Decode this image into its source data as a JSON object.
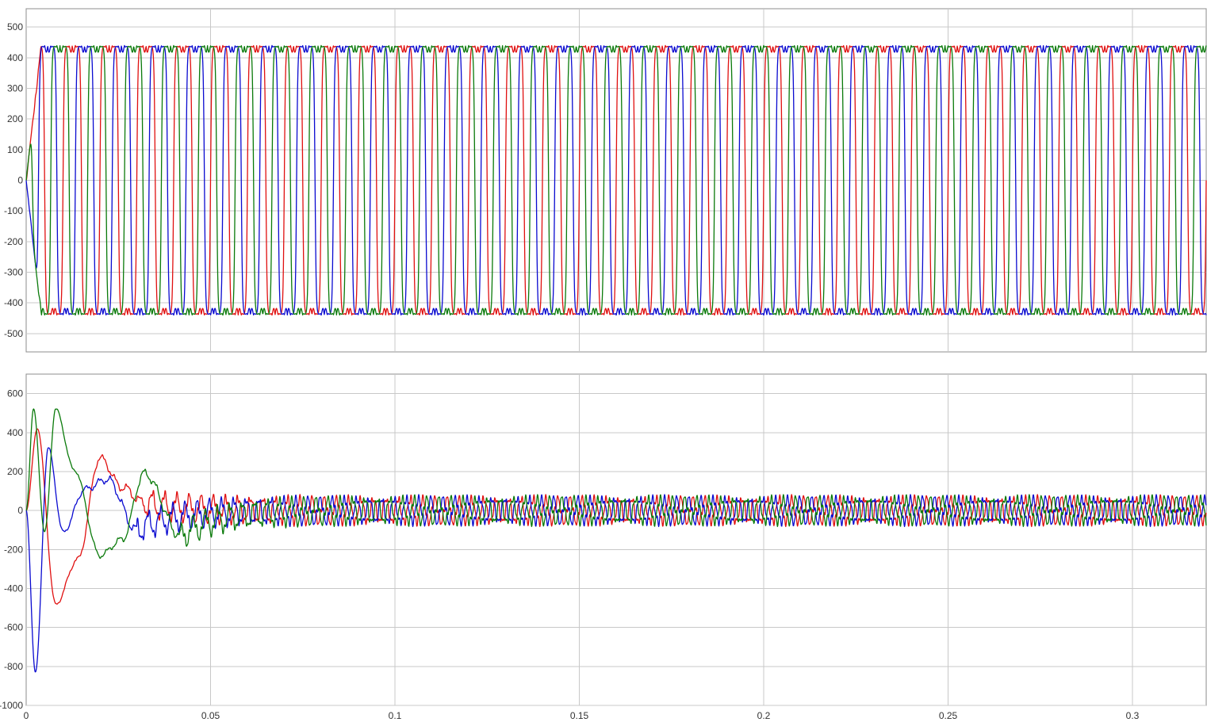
{
  "chart_data": [
    {
      "type": "line",
      "title": "",
      "xlabel": "",
      "ylabel": "",
      "grid": true,
      "xlim": [
        0,
        0.32
      ],
      "ylim": [
        -560,
        560
      ],
      "xticks": [
        0,
        0.05,
        0.1,
        0.15,
        0.2,
        0.25,
        0.3
      ],
      "xtick_labels": [
        "",
        "",
        "",
        "",
        "",
        "",
        ""
      ],
      "yticks": [
        500,
        400,
        300,
        200,
        100,
        0,
        -100,
        -200,
        -300,
        -400,
        -500
      ],
      "ytick_labels": [
        "500",
        "400",
        "300",
        "200",
        "100",
        "0",
        "-100",
        "-200",
        "-300",
        "-400",
        "-500"
      ],
      "series_colors": [
        "#e01010",
        "#0a0ad0",
        "#0a7a0a"
      ],
      "series": [
        {
          "values": {
            "shape": "three-phase quasi-square wave with double peaks",
            "frequency_hz": 100,
            "amplitude": 440,
            "phase_deg": 0
          }
        },
        {
          "values": {
            "shape": "three-phase quasi-square wave with double peaks",
            "frequency_hz": 100,
            "amplitude": 440,
            "phase_deg": -120
          }
        },
        {
          "values": {
            "shape": "three-phase quasi-square wave with double peaks",
            "frequency_hz": 100,
            "amplitude": 440,
            "phase_deg": 120
          }
        }
      ]
    },
    {
      "type": "line",
      "title": "",
      "xlabel": "",
      "ylabel": "",
      "grid": true,
      "xlim": [
        0,
        0.32
      ],
      "ylim": [
        -1000,
        700
      ],
      "xticks": [
        0,
        0.05,
        0.1,
        0.15,
        0.2,
        0.25,
        0.3
      ],
      "xtick_labels": [
        "0",
        "0.05",
        "0.1",
        "0.15",
        "0.2",
        "0.25",
        "0.3"
      ],
      "yticks": [
        600,
        400,
        200,
        0,
        -200,
        -400,
        -600,
        -800,
        -1000
      ],
      "ytick_labels": [
        "600",
        "400",
        "200",
        "0",
        "-200",
        "-400",
        "-600",
        "-800",
        "-1000"
      ],
      "series_colors": [
        "#e01010",
        "#0a0ad0",
        "#0a7a0a"
      ],
      "series": [
        {
          "values": {
            "transient_points": [
              [
                0,
                0
              ],
              [
                0.003,
                420
              ],
              [
                0.008,
                -480
              ],
              [
                0.014,
                -250
              ],
              [
                0.02,
                270
              ],
              [
                0.026,
                120
              ],
              [
                0.032,
                40
              ]
            ],
            "steady_state_amplitude": 80,
            "steady_state_frequency_hz": 300
          }
        },
        {
          "values": {
            "transient_points": [
              [
                0,
                0
              ],
              [
                0.0025,
                -830
              ],
              [
                0.006,
                320
              ],
              [
                0.01,
                -110
              ],
              [
                0.016,
                110
              ],
              [
                0.022,
                160
              ],
              [
                0.03,
                -100
              ]
            ],
            "steady_state_amplitude": 80,
            "steady_state_frequency_hz": 300
          }
        },
        {
          "values": {
            "transient_points": [
              [
                0,
                0
              ],
              [
                0.002,
                520
              ],
              [
                0.005,
                -110
              ],
              [
                0.008,
                520
              ],
              [
                0.013,
                210
              ],
              [
                0.02,
                -230
              ],
              [
                0.026,
                -150
              ],
              [
                0.032,
                190
              ],
              [
                0.042,
                -130
              ]
            ],
            "steady_state_amplitude": 80,
            "steady_state_frequency_hz": 300
          }
        }
      ]
    }
  ]
}
